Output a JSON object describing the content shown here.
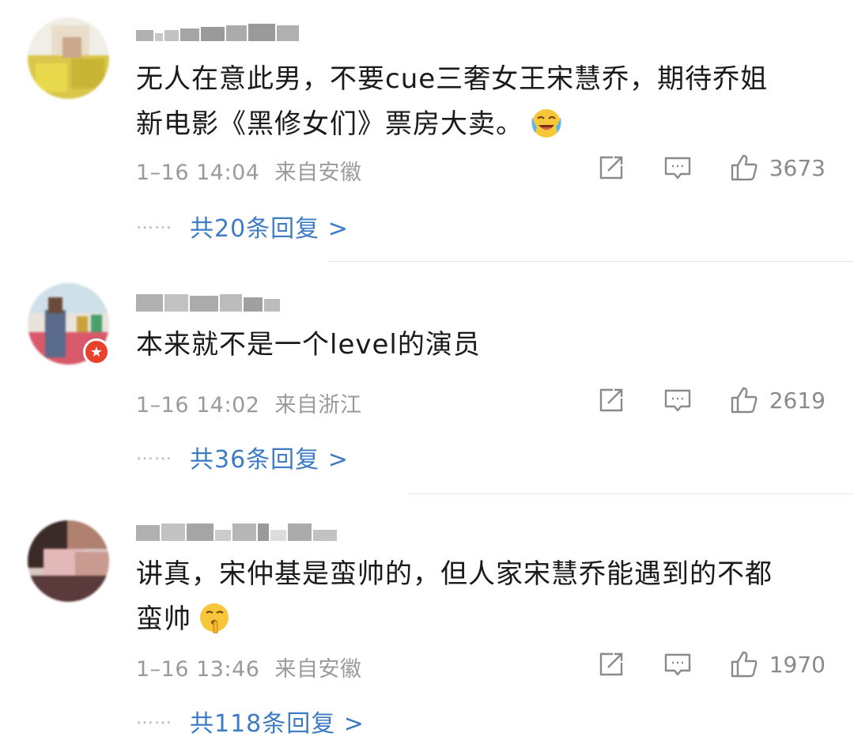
{
  "comments": [
    {
      "text_line1": "无人在意此男，不要cue三奢女王宋慧乔，期待乔姐",
      "text_line2": "新电影《黑修女们》票房大卖。",
      "time": "1–16 14:04",
      "location": "来自安徽",
      "likes": "3673",
      "replies": "共20条回复 >",
      "emoji": "laughing-tears-emoji"
    },
    {
      "text_line1": "本来就不是一个level的演员",
      "time": "1–16 14:02",
      "location": "来自浙江",
      "likes": "2619",
      "replies": "共36条回复 >",
      "badge": "vip-badge"
    },
    {
      "text_line1": "讲真，宋仲基是蛮帅的，但人家宋慧乔能遇到的不都",
      "text_line2": "蛮帅",
      "time": "1–16 13:46",
      "location": "来自安徽",
      "likes": "1970",
      "replies": "共118条回复 >",
      "emoji": "shushing-face-emoji"
    }
  ],
  "reply_dots": "……",
  "colors": {
    "link": "#3d7cc4",
    "meta": "#9a9a9a",
    "text": "#1a1a1a"
  }
}
